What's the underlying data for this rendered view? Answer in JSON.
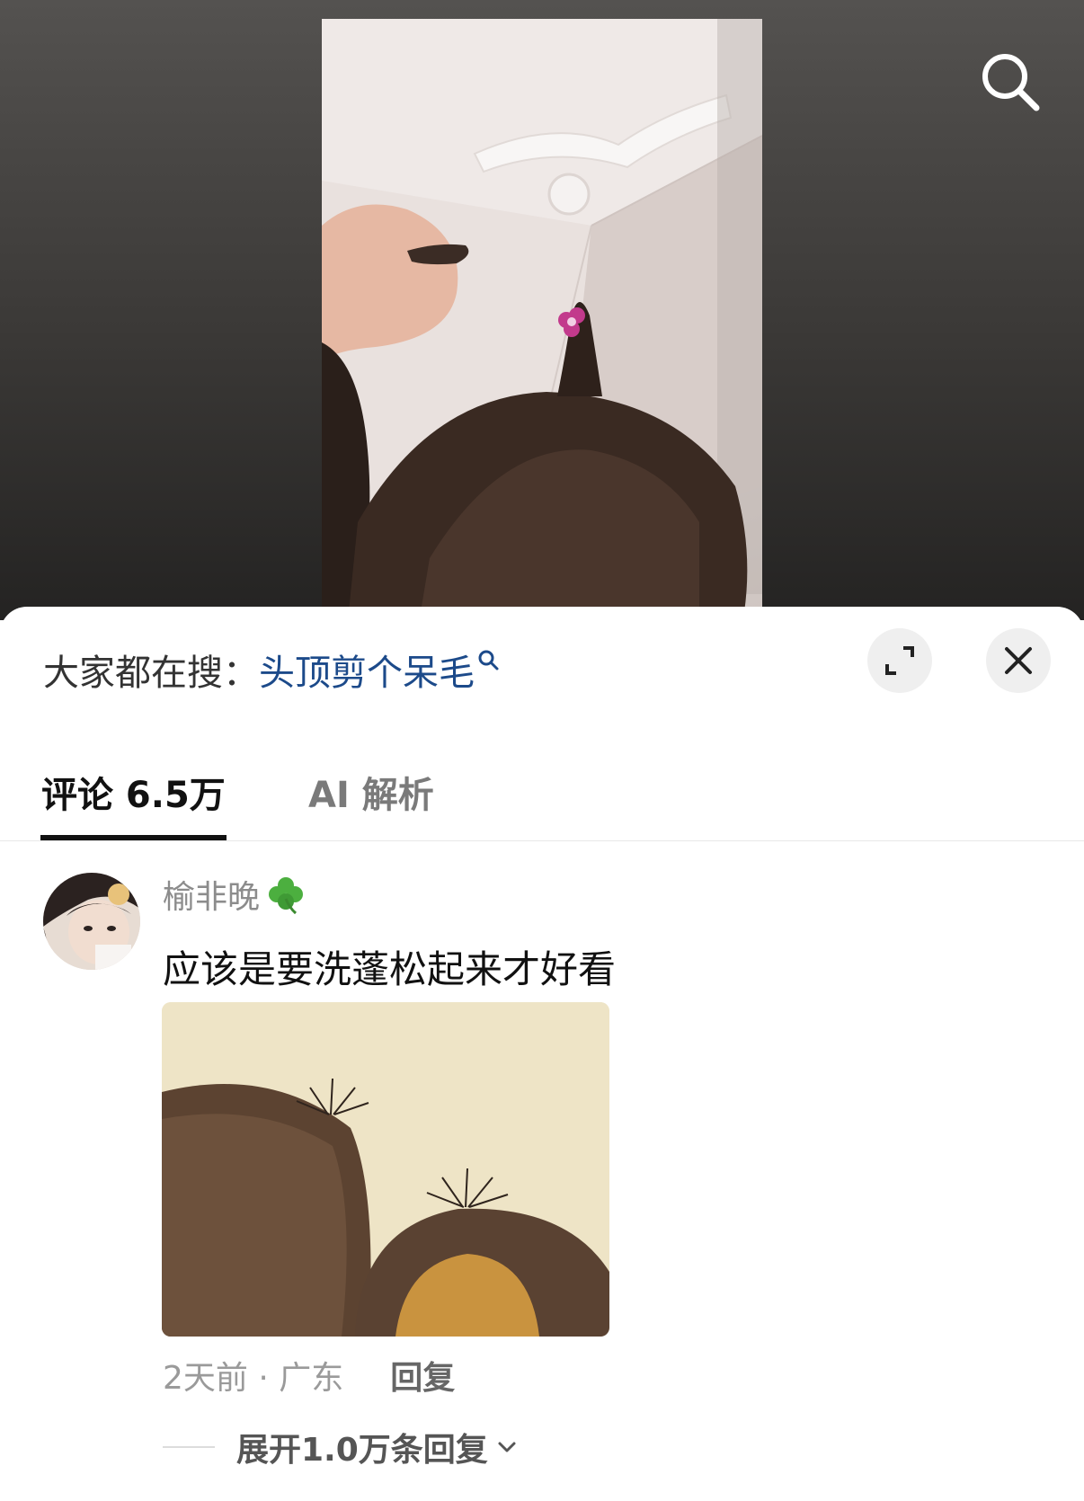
{
  "trending": {
    "prefix": "大家都在搜：",
    "query": "头顶剪个呆毛"
  },
  "tabs": [
    {
      "label": "评论 6.5万",
      "active": true
    },
    {
      "label": "AI 解析",
      "active": false
    }
  ],
  "comment": {
    "username": "榆非晚",
    "username_emoji": "four-leaf-clover",
    "text": "应该是要洗蓬松起来才好看",
    "time_location": "2天前 · 广东",
    "reply_label": "回复",
    "expand_replies_label": "展开1.0万条回复"
  },
  "icons": {
    "search": "search-icon",
    "expand": "expand-icon",
    "close": "close-icon",
    "trending_search": "search-icon",
    "chevron": "chevron-down-icon"
  },
  "colors": {
    "link": "#1c4a8a",
    "text_primary": "#111111",
    "text_secondary": "#8c8c8c",
    "divider": "#e8e8e8"
  }
}
